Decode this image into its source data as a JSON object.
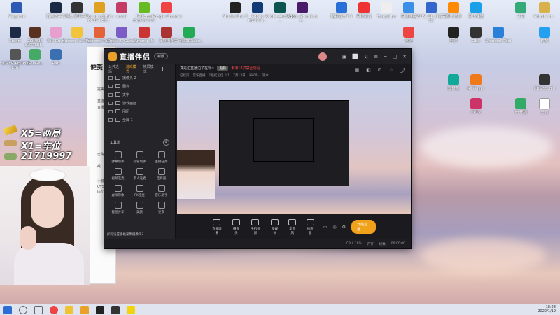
{
  "desktop": {
    "top_row": [
      "Wegame",
      "冒险岛平台",
      "地板游戏平台",
      "Counter-Strike Global Off...",
      "excel",
      "GeForce Experience",
      "Google Chrome",
      "Studio One 3",
      "Adobe Photosh...",
      "Adobe Audition ...",
      "Adobe Premiere P...",
      "酷我音乐7.3",
      "央视影音",
      "Freepiano",
      "百度网盘",
      "2019_01_抖音完成",
      "腾讯视频",
      "腾讯课堂",
      "钉钉",
      "Administr..."
    ],
    "second_row": [
      "Steam",
      "ZOMBIE BATTLEF...",
      "Fall Guys",
      "Human Fall Flat",
      "Portmod Party",
      "Drate & Guess",
      "Among Us",
      "多层图图",
      "大富翁10Rebo...",
      "喀喀",
      "剪映",
      "OBS",
      "Uninstall Tool",
      "优酷"
    ],
    "third_row": [
      "SUPER PEOPLE CBT",
      "GeeGee",
      "Raft",
      "爱奇艺",
      "AirPlayer",
      "CBS Studio",
      "PPTV",
      "YY开播",
      "元宵"
    ]
  },
  "bg_window": {
    "title": "便笺",
    "lines": [
      "完美",
      "直连",
      "直播",
      "已确",
      "截",
      "小鹿",
      "UTS",
      "lu01"
    ]
  },
  "app": {
    "title": "直播伴侣",
    "badge": "新版",
    "title_icons": [
      "▣",
      "⬜",
      "♫",
      "≡",
      "─",
      "□",
      "✕"
    ],
    "tabs": [
      "公共之场",
      "游戏模式",
      "横屏模式"
    ],
    "active_tab": "游戏模式",
    "scenes": [
      "摄像头 2",
      "图片 1",
      "文字",
      "游戏画面",
      "团团",
      "全屏 1"
    ],
    "tools_header": "工具箱",
    "tools": [
      "弹幕助手",
      "房管助手",
      "主播任务",
      "视频连麦",
      "多人连麦",
      "选择器",
      "虚拟形象",
      "PK连麦",
      "音乐助手",
      "截图分享",
      "美颜",
      "更多"
    ],
    "left_footer": "如何设置手机采集摄像头?",
    "top_info": {
      "text": "真是边直播边了在玩~",
      "tag": "更新",
      "warn": "未满18岁禁止观看"
    },
    "top_info2": [
      "已结束",
      "音乐直播",
      "1级红包位 0/1",
      "7月13日",
      "11781",
      "观众"
    ],
    "bottom_actions": [
      "直播屏幕",
      "摄像头",
      "手机投屏",
      "多媒体",
      "麦克风",
      "扬声器"
    ],
    "bottom_right_icons": [
      "▭",
      "◎",
      "⚙"
    ],
    "start_button": "开始直播",
    "status": [
      "CPU: 18%",
      "内存",
      "帧数",
      "00:00:00"
    ]
  },
  "overlay": {
    "line1": "X5=两局",
    "line2": "X1=车位",
    "line3": "21719997"
  },
  "taskbar": {
    "time": "18:28",
    "date": "2022/1/19"
  }
}
